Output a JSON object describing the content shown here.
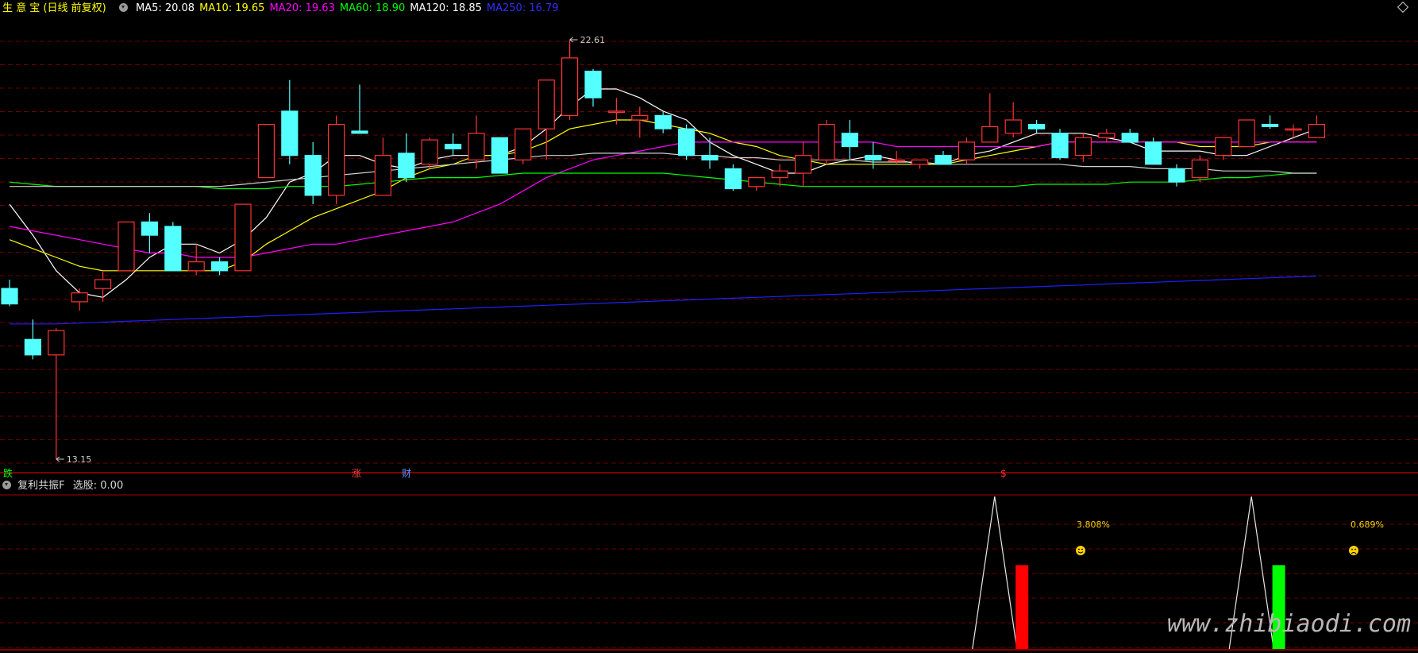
{
  "header": {
    "stock_name": "生 意 宝",
    "period_label": "(日线 前复权)",
    "ma_values": [
      {
        "label": "MA5: 20.08",
        "color": "#ffffff"
      },
      {
        "label": "MA10: 19.65",
        "color": "#ffff00"
      },
      {
        "label": "MA20: 19.63",
        "color": "#ff00ff"
      },
      {
        "label": "MA60: 18.90",
        "color": "#00ff00"
      },
      {
        "label": "MA120: 18.85",
        "color": "#ffffff"
      },
      {
        "label": "MA250: 16.79",
        "color": "#3030ff"
      }
    ]
  },
  "sub_header": {
    "indicator_name": "复利共振F",
    "indicator_value": "选股: 0.00"
  },
  "markers": {
    "high_label": "22.61",
    "low_label": "13.15",
    "event_die": "跌",
    "event_zhang": "涨",
    "event_cai": "财",
    "event_dollar": "$"
  },
  "annotations": {
    "pct1": "3.808%",
    "pct2": "0.689%",
    "watermark": "www.zhibiaodi.com"
  },
  "chart_data": {
    "type": "candlestick",
    "price_range": [
      13.15,
      22.61
    ],
    "candles": [
      {
        "o": 17.0,
        "c": 16.65,
        "h": 17.2,
        "l": 16.6,
        "dir": "down"
      },
      {
        "o": 15.85,
        "c": 15.5,
        "h": 16.3,
        "l": 15.4,
        "dir": "down"
      },
      {
        "o": 15.5,
        "c": 16.05,
        "h": 16.1,
        "l": 13.15,
        "dir": "up"
      },
      {
        "o": 16.7,
        "c": 16.9,
        "h": 17.0,
        "l": 16.5,
        "dir": "up"
      },
      {
        "o": 17.0,
        "c": 17.2,
        "h": 17.4,
        "l": 16.7,
        "dir": "up"
      },
      {
        "o": 17.4,
        "c": 18.5,
        "h": 18.5,
        "l": 17.4,
        "dir": "up"
      },
      {
        "o": 18.5,
        "c": 18.2,
        "h": 18.7,
        "l": 17.8,
        "dir": "down"
      },
      {
        "o": 18.4,
        "c": 17.4,
        "h": 18.5,
        "l": 17.4,
        "dir": "down"
      },
      {
        "o": 17.4,
        "c": 17.6,
        "h": 18.0,
        "l": 17.3,
        "dir": "up"
      },
      {
        "o": 17.6,
        "c": 17.4,
        "h": 17.7,
        "l": 17.3,
        "dir": "down"
      },
      {
        "o": 17.4,
        "c": 18.9,
        "h": 18.9,
        "l": 17.4,
        "dir": "up"
      },
      {
        "o": 19.5,
        "c": 20.7,
        "h": 20.7,
        "l": 19.5,
        "dir": "up"
      },
      {
        "o": 21.0,
        "c": 20.0,
        "h": 21.7,
        "l": 19.8,
        "dir": "down"
      },
      {
        "o": 20.0,
        "c": 19.1,
        "h": 20.3,
        "l": 18.9,
        "dir": "down"
      },
      {
        "o": 19.1,
        "c": 20.7,
        "h": 20.9,
        "l": 18.9,
        "dir": "up"
      },
      {
        "o": 20.55,
        "c": 20.5,
        "h": 21.6,
        "l": 20.5,
        "dir": "down"
      },
      {
        "o": 19.1,
        "c": 20.0,
        "h": 20.4,
        "l": 19.1,
        "dir": "up"
      },
      {
        "o": 20.05,
        "c": 19.5,
        "h": 20.5,
        "l": 19.4,
        "dir": "down"
      },
      {
        "o": 19.8,
        "c": 20.35,
        "h": 20.4,
        "l": 19.7,
        "dir": "up"
      },
      {
        "o": 20.25,
        "c": 20.15,
        "h": 20.5,
        "l": 20.0,
        "dir": "down"
      },
      {
        "o": 19.9,
        "c": 20.5,
        "h": 20.9,
        "l": 19.7,
        "dir": "up"
      },
      {
        "o": 20.4,
        "c": 19.6,
        "h": 20.4,
        "l": 19.6,
        "dir": "down"
      },
      {
        "o": 19.9,
        "c": 20.6,
        "h": 20.6,
        "l": 19.8,
        "dir": "up"
      },
      {
        "o": 20.6,
        "c": 21.7,
        "h": 21.7,
        "l": 19.9,
        "dir": "up"
      },
      {
        "o": 20.9,
        "c": 22.2,
        "h": 22.61,
        "l": 20.8,
        "dir": "up"
      },
      {
        "o": 21.9,
        "c": 21.3,
        "h": 21.95,
        "l": 21.1,
        "dir": "down"
      },
      {
        "o": 21.0,
        "c": 21.0,
        "h": 21.3,
        "l": 20.7,
        "dir": "up"
      },
      {
        "o": 20.8,
        "c": 20.9,
        "h": 21.1,
        "l": 20.4,
        "dir": "up"
      },
      {
        "o": 20.9,
        "c": 20.6,
        "h": 21.0,
        "l": 20.5,
        "dir": "down"
      },
      {
        "o": 20.6,
        "c": 20.0,
        "h": 20.7,
        "l": 19.9,
        "dir": "down"
      },
      {
        "o": 20.0,
        "c": 19.9,
        "h": 20.4,
        "l": 19.7,
        "dir": "down"
      },
      {
        "o": 19.7,
        "c": 19.25,
        "h": 19.8,
        "l": 19.2,
        "dir": "down"
      },
      {
        "o": 19.3,
        "c": 19.5,
        "h": 19.5,
        "l": 19.2,
        "dir": "up"
      },
      {
        "o": 19.5,
        "c": 19.65,
        "h": 19.8,
        "l": 19.3,
        "dir": "up"
      },
      {
        "o": 19.6,
        "c": 20.0,
        "h": 20.3,
        "l": 19.3,
        "dir": "up"
      },
      {
        "o": 19.9,
        "c": 20.7,
        "h": 20.8,
        "l": 19.8,
        "dir": "up"
      },
      {
        "o": 20.5,
        "c": 20.2,
        "h": 20.8,
        "l": 19.9,
        "dir": "down"
      },
      {
        "o": 20.0,
        "c": 19.9,
        "h": 20.3,
        "l": 19.7,
        "dir": "down"
      },
      {
        "o": 19.9,
        "c": 19.9,
        "h": 20.1,
        "l": 19.8,
        "dir": "up"
      },
      {
        "o": 19.8,
        "c": 19.9,
        "h": 19.9,
        "l": 19.7,
        "dir": "up"
      },
      {
        "o": 20.0,
        "c": 19.8,
        "h": 20.1,
        "l": 19.8,
        "dir": "down"
      },
      {
        "o": 19.9,
        "c": 20.3,
        "h": 20.4,
        "l": 19.8,
        "dir": "up"
      },
      {
        "o": 20.3,
        "c": 20.65,
        "h": 21.4,
        "l": 20.3,
        "dir": "up"
      },
      {
        "o": 20.5,
        "c": 20.8,
        "h": 21.2,
        "l": 20.4,
        "dir": "up"
      },
      {
        "o": 20.7,
        "c": 20.6,
        "h": 20.8,
        "l": 20.5,
        "dir": "down"
      },
      {
        "o": 20.5,
        "c": 19.95,
        "h": 20.6,
        "l": 19.9,
        "dir": "down"
      },
      {
        "o": 20.0,
        "c": 20.4,
        "h": 20.5,
        "l": 19.85,
        "dir": "up"
      },
      {
        "o": 20.4,
        "c": 20.5,
        "h": 20.6,
        "l": 20.3,
        "dir": "up"
      },
      {
        "o": 20.5,
        "c": 20.3,
        "h": 20.6,
        "l": 20.3,
        "dir": "down"
      },
      {
        "o": 20.3,
        "c": 19.8,
        "h": 20.4,
        "l": 19.8,
        "dir": "down"
      },
      {
        "o": 19.7,
        "c": 19.4,
        "h": 19.8,
        "l": 19.3,
        "dir": "down"
      },
      {
        "o": 19.5,
        "c": 19.9,
        "h": 20.0,
        "l": 19.4,
        "dir": "up"
      },
      {
        "o": 20.0,
        "c": 20.4,
        "h": 20.4,
        "l": 19.9,
        "dir": "up"
      },
      {
        "o": 20.2,
        "c": 20.8,
        "h": 20.8,
        "l": 20.2,
        "dir": "up"
      },
      {
        "o": 20.7,
        "c": 20.65,
        "h": 20.9,
        "l": 20.6,
        "dir": "down"
      },
      {
        "o": 20.6,
        "c": 20.6,
        "h": 20.7,
        "l": 20.4,
        "dir": "up"
      },
      {
        "o": 20.4,
        "c": 20.7,
        "h": 20.9,
        "l": 20.4,
        "dir": "up"
      }
    ],
    "ma_lines": [
      {
        "name": "MA5",
        "color": "#ffffff",
        "values": [
          18.9,
          18.2,
          17.4,
          16.9,
          16.8,
          17.2,
          17.7,
          18.0,
          18.0,
          17.8,
          18.1,
          18.6,
          19.4,
          19.6,
          20.0,
          20.0,
          19.8,
          19.7,
          19.9,
          20.0,
          20.0,
          20.0,
          20.2,
          20.6,
          21.1,
          21.5,
          21.5,
          21.3,
          21.0,
          20.8,
          20.3,
          20.0,
          19.8,
          19.6,
          19.6,
          19.8,
          19.9,
          20.0,
          19.9,
          19.8,
          19.8,
          20.0,
          20.1,
          20.3,
          20.5,
          20.5,
          20.5,
          20.4,
          20.3,
          20.1,
          20.1,
          20.1,
          20.0,
          20.0,
          20.2,
          20.4,
          20.6
        ]
      },
      {
        "name": "MA10",
        "color": "#ffff00",
        "values": [
          18.1,
          17.9,
          17.7,
          17.5,
          17.4,
          17.4,
          17.4,
          17.4,
          17.4,
          17.4,
          17.6,
          18.0,
          18.3,
          18.6,
          18.8,
          19.0,
          19.2,
          19.5,
          19.7,
          19.8,
          20.0,
          20.0,
          20.1,
          20.3,
          20.6,
          20.7,
          20.8,
          20.8,
          20.7,
          20.6,
          20.5,
          20.3,
          20.2,
          20.0,
          19.9,
          19.8,
          19.8,
          19.8,
          19.8,
          19.8,
          19.8,
          19.9,
          20.0,
          20.1,
          20.2,
          20.3,
          20.3,
          20.3,
          20.3,
          20.3,
          20.3,
          20.2,
          20.2,
          20.2,
          20.3,
          20.3,
          20.3
        ]
      },
      {
        "name": "MA20",
        "color": "#ff00ff",
        "values": [
          18.4,
          18.3,
          18.2,
          18.1,
          18.0,
          17.9,
          17.8,
          17.8,
          17.7,
          17.7,
          17.7,
          17.8,
          17.9,
          18.0,
          18.0,
          18.1,
          18.2,
          18.3,
          18.4,
          18.5,
          18.7,
          18.9,
          19.2,
          19.5,
          19.7,
          19.9,
          20.0,
          20.1,
          20.2,
          20.3,
          20.3,
          20.3,
          20.3,
          20.3,
          20.3,
          20.3,
          20.3,
          20.3,
          20.2,
          20.2,
          20.2,
          20.2,
          20.2,
          20.2,
          20.2,
          20.3,
          20.3,
          20.3,
          20.3,
          20.3,
          20.3,
          20.3,
          20.3,
          20.3,
          20.3,
          20.3,
          20.3
        ]
      },
      {
        "name": "MA60",
        "color": "#00ff00",
        "values": [
          19.4,
          19.35,
          19.3,
          19.3,
          19.3,
          19.3,
          19.3,
          19.3,
          19.3,
          19.25,
          19.25,
          19.25,
          19.3,
          19.3,
          19.3,
          19.35,
          19.4,
          19.45,
          19.5,
          19.5,
          19.5,
          19.55,
          19.6,
          19.6,
          19.6,
          19.6,
          19.6,
          19.6,
          19.6,
          19.55,
          19.5,
          19.45,
          19.4,
          19.35,
          19.3,
          19.3,
          19.3,
          19.3,
          19.3,
          19.3,
          19.3,
          19.3,
          19.3,
          19.3,
          19.35,
          19.35,
          19.35,
          19.35,
          19.4,
          19.4,
          19.4,
          19.45,
          19.5,
          19.5,
          19.55,
          19.6,
          19.6
        ]
      },
      {
        "name": "MA120",
        "color": "#d0d0d0",
        "values": [
          19.3,
          19.3,
          19.3,
          19.3,
          19.3,
          19.3,
          19.3,
          19.3,
          19.3,
          19.3,
          19.35,
          19.4,
          19.45,
          19.5,
          19.55,
          19.6,
          19.65,
          19.7,
          19.75,
          19.8,
          19.85,
          19.9,
          19.95,
          20.0,
          20.0,
          20.05,
          20.05,
          20.05,
          20.05,
          20.0,
          20.0,
          19.95,
          19.95,
          19.9,
          19.9,
          19.9,
          19.9,
          19.85,
          19.85,
          19.85,
          19.8,
          19.8,
          19.8,
          19.8,
          19.8,
          19.8,
          19.75,
          19.75,
          19.75,
          19.7,
          19.7,
          19.7,
          19.65,
          19.65,
          19.65,
          19.6,
          19.6
        ]
      },
      {
        "name": "MA250",
        "color": "#2020ff",
        "values": [
          16.2,
          16.2,
          16.2,
          16.22,
          16.24,
          16.26,
          16.28,
          16.3,
          16.32,
          16.34,
          16.36,
          16.38,
          16.4,
          16.42,
          16.44,
          16.46,
          16.48,
          16.5,
          16.52,
          16.54,
          16.56,
          16.58,
          16.6,
          16.62,
          16.64,
          16.66,
          16.68,
          16.7,
          16.72,
          16.74,
          16.76,
          16.78,
          16.8,
          16.82,
          16.84,
          16.86,
          16.88,
          16.9,
          16.92,
          16.94,
          16.96,
          16.98,
          17.0,
          17.02,
          17.04,
          17.06,
          17.08,
          17.1,
          17.12,
          17.14,
          17.16,
          17.18,
          17.2,
          17.22,
          17.24,
          17.26,
          17.28
        ]
      }
    ],
    "sub_bars": [
      {
        "index": 43,
        "value": 0.55,
        "color": "#ff0000"
      },
      {
        "index": 54,
        "value": 0.55,
        "color": "#00ff00"
      }
    ],
    "sub_spikes": [
      {
        "index": 42,
        "value": 1.0
      },
      {
        "index": 53,
        "value": 1.0
      }
    ]
  }
}
